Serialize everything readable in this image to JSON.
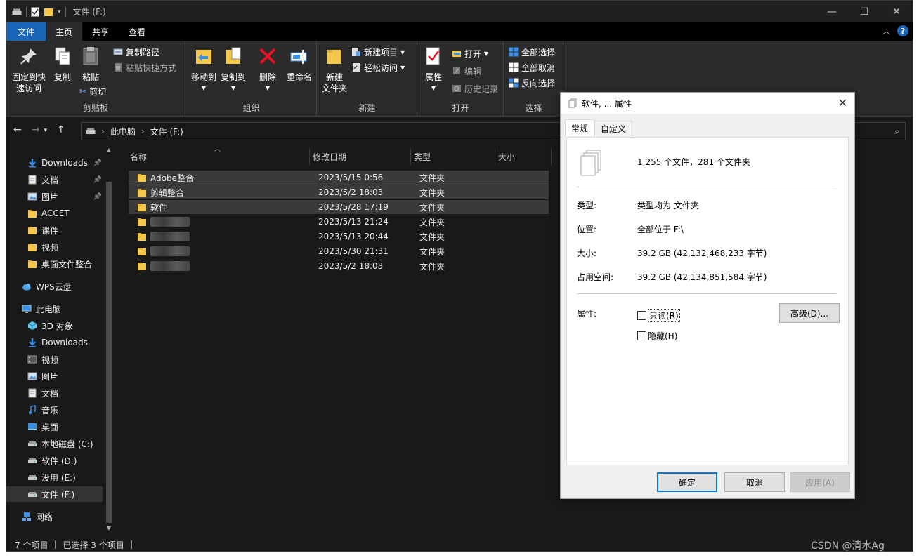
{
  "window": {
    "title": "文件 (F:)",
    "controls": [
      "—",
      "☐",
      "✕"
    ]
  },
  "ribbon_tabs": [
    {
      "label": "文件"
    },
    {
      "label": "主页"
    },
    {
      "label": "共享"
    },
    {
      "label": "查看"
    }
  ],
  "ribbon": {
    "clipboard": {
      "label": "剪贴板",
      "pin_line1": "固定到快",
      "pin_line2": "速访问",
      "copy": "复制",
      "paste": "粘贴",
      "copy_path": "复制路径",
      "paste_shortcut": "粘贴快捷方式",
      "cut": "剪切"
    },
    "organize": {
      "label": "组织",
      "move_to": "移动到",
      "copy_to": "复制到",
      "delete": "删除",
      "rename": "重命名"
    },
    "new": {
      "label": "新建",
      "new_folder_line1": "新建",
      "new_folder_line2": "文件夹",
      "new_item": "新建项目",
      "easy_access": "轻松访问"
    },
    "open": {
      "label": "打开",
      "properties": "属性",
      "open": "打开",
      "edit": "编辑",
      "history": "历史记录"
    },
    "select": {
      "label": "选择",
      "select_all": "全部选择",
      "select_none": "全部取消",
      "invert": "反向选择"
    }
  },
  "address": {
    "crumbs": [
      "此电脑",
      "文件 (F:)"
    ]
  },
  "nav": {
    "items": [
      {
        "label": "Downloads",
        "icon": "download-arrow-icon",
        "pinned": true
      },
      {
        "label": "文档",
        "icon": "document-icon",
        "pinned": true
      },
      {
        "label": "图片",
        "icon": "picture-icon",
        "pinned": true
      },
      {
        "label": "ACCET",
        "icon": "folder-icon"
      },
      {
        "label": "课件",
        "icon": "folder-icon"
      },
      {
        "label": "视频",
        "icon": "folder-icon"
      },
      {
        "label": "桌面文件整合",
        "icon": "folder-icon"
      },
      {
        "label": "WPS云盘",
        "icon": "cloud-icon"
      },
      {
        "label": "此电脑",
        "icon": "computer-icon"
      },
      {
        "label": "3D 对象",
        "icon": "cube-icon"
      },
      {
        "label": "Downloads",
        "icon": "download-arrow-icon"
      },
      {
        "label": "视频",
        "icon": "video-icon"
      },
      {
        "label": "图片",
        "icon": "picture-icon"
      },
      {
        "label": "文档",
        "icon": "document-icon"
      },
      {
        "label": "音乐",
        "icon": "music-icon"
      },
      {
        "label": "桌面",
        "icon": "desktop-icon"
      },
      {
        "label": "本地磁盘 (C:)",
        "icon": "drive-icon"
      },
      {
        "label": "软件 (D:)",
        "icon": "drive-icon"
      },
      {
        "label": "没用 (E:)",
        "icon": "drive-icon"
      },
      {
        "label": "文件 (F:)",
        "icon": "drive-icon",
        "selected": true
      },
      {
        "label": "网络",
        "icon": "network-icon"
      }
    ]
  },
  "columns": [
    "名称",
    "修改日期",
    "类型",
    "大小"
  ],
  "files": [
    {
      "name": "Adobe整合",
      "date": "2023/5/15 0:56",
      "type": "文件夹",
      "selected": true
    },
    {
      "name": "剪辑整合",
      "date": "2023/5/2 18:03",
      "type": "文件夹",
      "selected": true
    },
    {
      "name": "软件",
      "date": "2023/5/28 17:19",
      "type": "文件夹",
      "selected": true
    },
    {
      "name": "",
      "date": "2023/5/13 21:24",
      "type": "文件夹",
      "obscured": true
    },
    {
      "name": "",
      "date": "2023/5/13 20:44",
      "type": "文件夹",
      "obscured": true
    },
    {
      "name": "",
      "date": "2023/5/30 21:31",
      "type": "文件夹",
      "obscured": true
    },
    {
      "name": "",
      "date": "2023/5/2 18:03",
      "type": "文件夹",
      "obscured": true
    }
  ],
  "status": {
    "count": "7 个项目",
    "selected": "已选择 3 个项目",
    "watermark": "CSDN @清水Ag"
  },
  "dialog": {
    "title": "软件, ... 属性",
    "tabs": [
      "常规",
      "自定义"
    ],
    "summary": "1,255 个文件，281 个文件夹",
    "type_label": "类型:",
    "type_value": "类型均为 文件夹",
    "location_label": "位置:",
    "location_value": "全部位于 F:\\",
    "size_label": "大小:",
    "size_value": "39.2 GB (42,132,468,233 字节)",
    "disk_label": "占用空间:",
    "disk_value": "39.2 GB (42,134,851,584 字节)",
    "attr_label": "属性:",
    "readonly": "只读(R)",
    "hidden": "隐藏(H)",
    "advanced": "高级(D)...",
    "ok": "确定",
    "cancel": "取消",
    "apply": "应用(A)"
  },
  "colors": {
    "accent": "#1a64b8",
    "folder": "#f5c84c",
    "bg": "#191919"
  }
}
